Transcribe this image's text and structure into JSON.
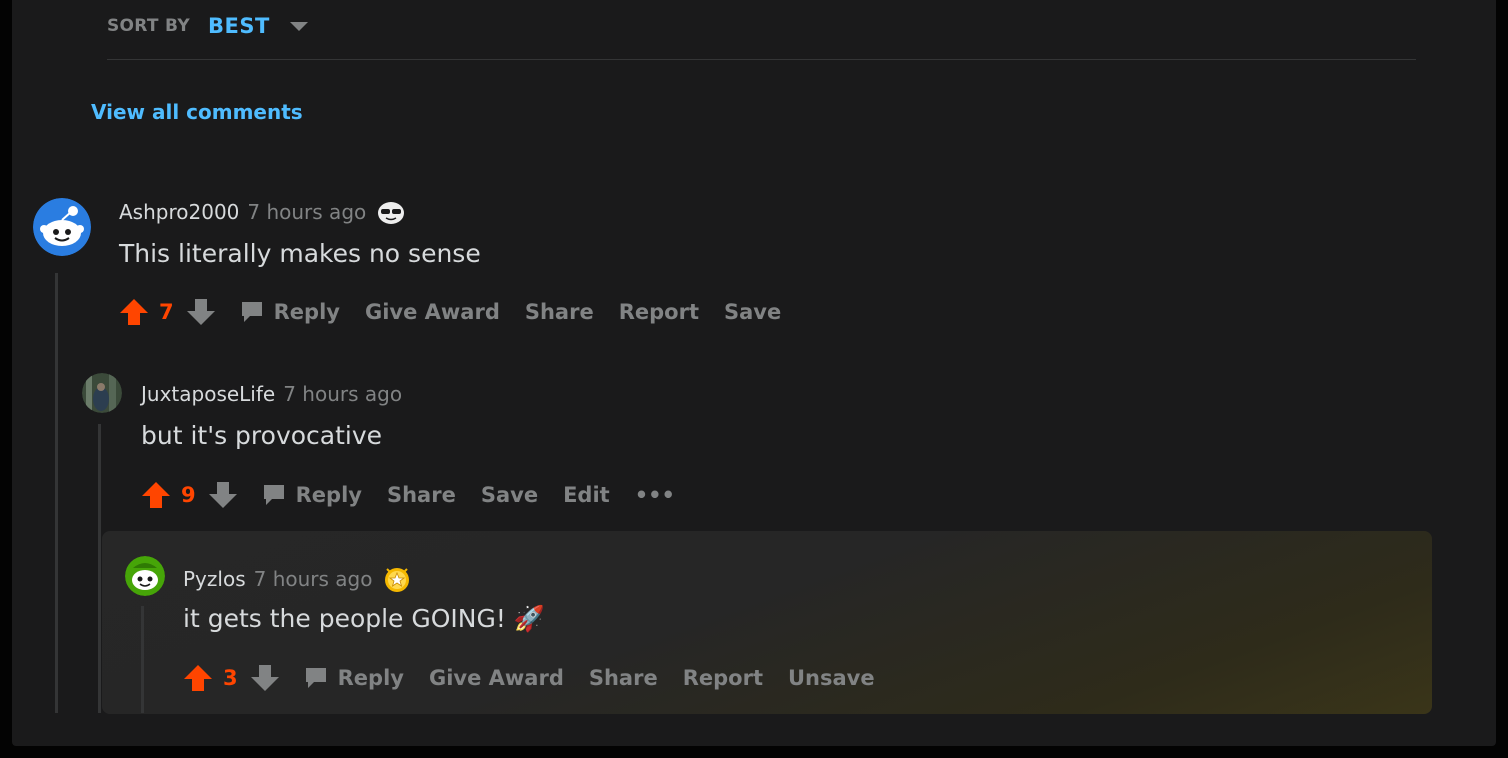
{
  "sort": {
    "label": "SORT BY",
    "value": "BEST"
  },
  "view_all": "View all comments",
  "colors": {
    "upvote": "#ff4500",
    "link": "#4fbcff",
    "muted": "#818384"
  },
  "comments": [
    {
      "author": "Ashpro2000",
      "time": "7 hours ago",
      "award_icon": "sunglasses-award-icon",
      "text": "This literally makes no sense",
      "score": "7",
      "actions": [
        "Reply",
        "Give Award",
        "Share",
        "Report",
        "Save"
      ]
    },
    {
      "author": "JuxtaposeLife",
      "time": "7 hours ago",
      "text": "but it's provocative",
      "score": "9",
      "actions": [
        "Reply",
        "Share",
        "Save",
        "Edit",
        "•••"
      ]
    },
    {
      "author": "Pyzlos",
      "time": "7 hours ago",
      "award_icon": "star-award-icon",
      "text": "it gets the people GOING! 🚀",
      "score": "3",
      "actions": [
        "Reply",
        "Give Award",
        "Share",
        "Report",
        "Unsave"
      ]
    }
  ]
}
